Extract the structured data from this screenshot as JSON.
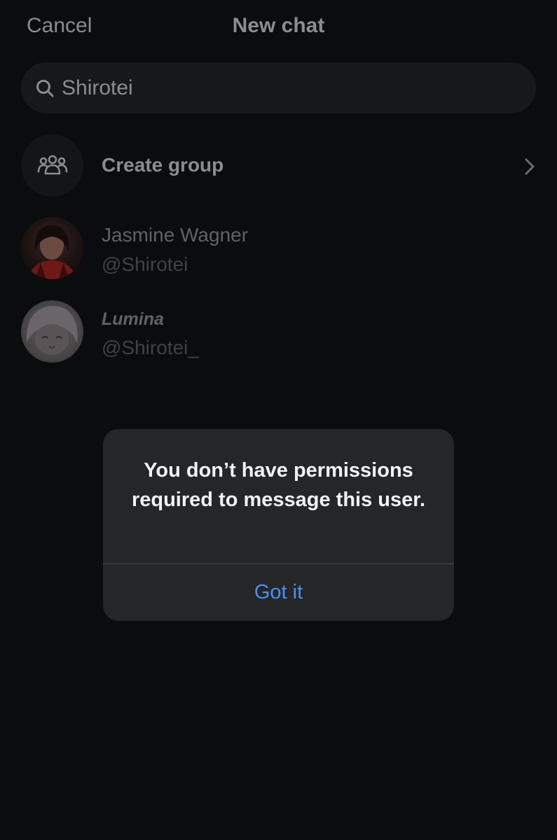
{
  "header": {
    "cancel_label": "Cancel",
    "title": "New chat"
  },
  "search": {
    "value": "Shirotei",
    "icon": "search-icon"
  },
  "create_group": {
    "label": "Create group",
    "icon": "group-icon"
  },
  "results": [
    {
      "name": "Jasmine Wagner",
      "handle": "@Shirotei"
    },
    {
      "name": "Lumina",
      "handle": "@Shirotei_"
    }
  ],
  "alert": {
    "message": "You don’t have permissions required to message this user.",
    "button_label": "Got it",
    "button_color": "#4a90f0"
  },
  "colors": {
    "background": "#0b0c0d",
    "alert_background": "#252628"
  }
}
